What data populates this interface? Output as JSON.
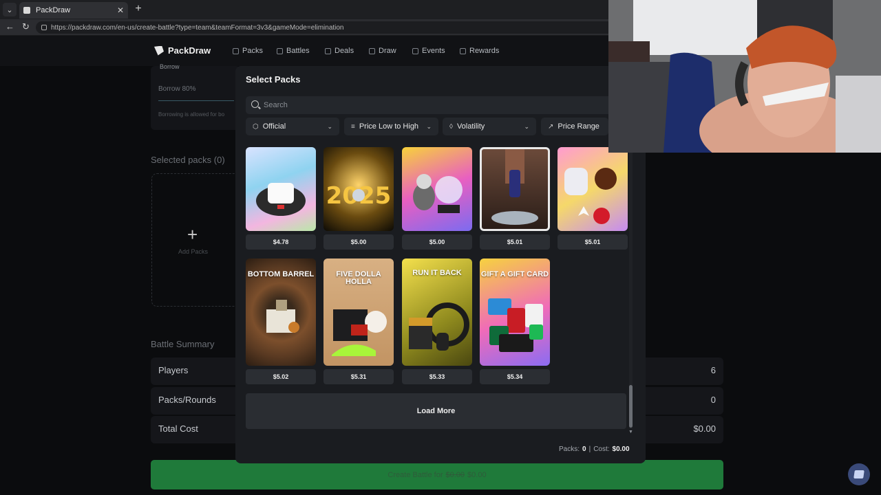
{
  "browser": {
    "tab_title": "PackDraw",
    "url": "https://packdraw.com/en-us/create-battle?type=team&teamFormat=3v3&gameMode=elimination"
  },
  "site": {
    "brand": "PackDraw",
    "nav": [
      "Packs",
      "Battles",
      "Deals",
      "Draw",
      "Events",
      "Rewards"
    ]
  },
  "page": {
    "borrow_heading": "Borrow",
    "borrow_value": "Borrow 80%",
    "borrow_note": "Borrowing is allowed for bo",
    "selected_packs_title": "Selected packs (0)",
    "add_packs_label": "Add Packs",
    "summary_title": "Battle Summary",
    "summary": [
      {
        "label": "Players",
        "value": "6"
      },
      {
        "label": "Packs/Rounds",
        "value": "0"
      },
      {
        "label": "Total Cost",
        "value": "$0.00"
      }
    ],
    "create_button": {
      "prefix": "Create Battle for",
      "old_price": "$0.00",
      "price": "$0.00"
    }
  },
  "modal": {
    "title": "Select Packs",
    "search_placeholder": "Search",
    "filters": [
      "Official",
      "Price Low to High",
      "Volatility",
      "Price Range"
    ],
    "packs": [
      {
        "label": "",
        "price": "$4.78"
      },
      {
        "label": "",
        "price": "$5.00"
      },
      {
        "label": "",
        "price": "$5.00"
      },
      {
        "label": "",
        "price": "$5.01"
      },
      {
        "label": "",
        "price": "$5.01"
      },
      {
        "label": "BOTTOM BARREL",
        "price": "$5.02"
      },
      {
        "label": "FIVE DOLLA HOLLA",
        "price": "$5.31"
      },
      {
        "label": "RUN IT BACK",
        "price": "$5.33"
      },
      {
        "label": "GIFT A GIFT CARD",
        "price": "$5.34"
      }
    ],
    "load_more": "Load More",
    "footer": {
      "packs_label": "Packs:",
      "packs_value": "0",
      "sep": "|",
      "cost_label": "Cost:",
      "cost_value": "$0.00"
    }
  },
  "colors": {
    "accent_green": "#1f7a3a",
    "modal_bg": "#1a1c20",
    "page_bg": "#0b0c0e"
  }
}
